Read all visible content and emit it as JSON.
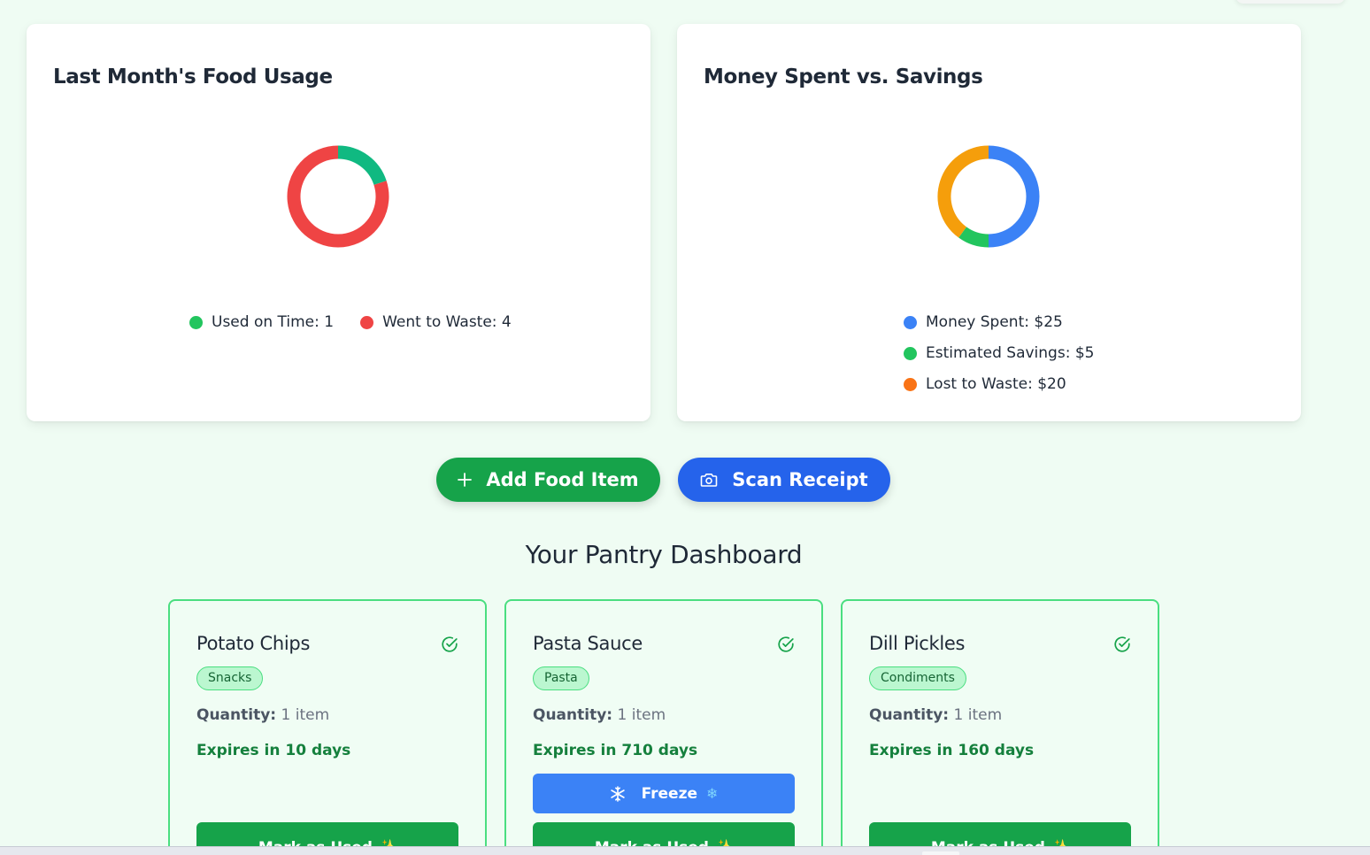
{
  "colors": {
    "background": "#effcf3",
    "used_on_time": "#22c55e",
    "went_to_waste": "#ef4444",
    "money_spent": "#3b82f6",
    "estimated_savings": "#22c55e",
    "lost_to_waste": "#f97316",
    "add_button": "#16a34a",
    "scan_button": "#2563eb"
  },
  "usage_card": {
    "title": "Last Month's Food Usage",
    "legend": [
      {
        "label": "Used on Time: 1"
      },
      {
        "label": "Went to Waste: 4"
      }
    ]
  },
  "money_card": {
    "title": "Money Spent vs. Savings",
    "legend": [
      {
        "label": "Money Spent: $25"
      },
      {
        "label": "Estimated Savings: $5"
      },
      {
        "label": "Lost to Waste: $20"
      }
    ]
  },
  "chart_data": [
    {
      "type": "pie",
      "title": "Last Month's Food Usage",
      "categories": [
        "Used on Time",
        "Went to Waste"
      ],
      "values": [
        1,
        4
      ],
      "colors": [
        "#10b981",
        "#ef4444"
      ],
      "legend": "bottom"
    },
    {
      "type": "pie",
      "title": "Money Spent vs. Savings",
      "categories": [
        "Money Spent",
        "Estimated Savings",
        "Lost to Waste"
      ],
      "values": [
        25,
        5,
        20
      ],
      "colors": [
        "#3b82f6",
        "#22c55e",
        "#f59e0b"
      ],
      "legend": "bottom"
    }
  ],
  "actions": {
    "add_label": "Add Food Item",
    "scan_label": "Scan Receipt",
    "add_icon": "plus-icon",
    "scan_icon": "camera-icon"
  },
  "dashboard": {
    "title": "Your Pantry Dashboard",
    "items": [
      {
        "name": "Potato Chips",
        "category": "Snacks",
        "quantity_label": "Quantity:",
        "quantity": "1 item",
        "expires": "Expires in 10 days",
        "used_label": "Mark as Used",
        "used_emoji": "✨",
        "status_icon": "check-circle-icon"
      },
      {
        "name": "Pasta Sauce",
        "category": "Pasta",
        "quantity_label": "Quantity:",
        "quantity": "1 item",
        "expires": "Expires in 710 days",
        "freeze_label": "Freeze",
        "freeze_emoji": "❄",
        "used_label": "Mark as Used",
        "used_emoji": "✨",
        "status_icon": "check-circle-icon"
      },
      {
        "name": "Dill Pickles",
        "category": "Condiments",
        "quantity_label": "Quantity:",
        "quantity": "1 item",
        "expires": "Expires in 160 days",
        "used_label": "Mark as Used",
        "used_emoji": "✨",
        "status_icon": "check-circle-icon"
      }
    ]
  }
}
